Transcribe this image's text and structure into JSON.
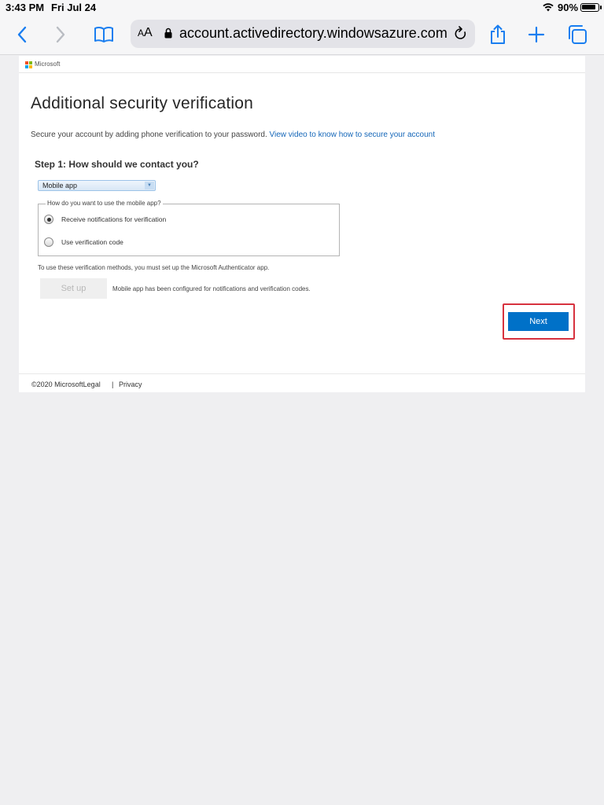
{
  "status_bar": {
    "time": "3:43 PM",
    "date": "Fri Jul 24",
    "battery": "90%"
  },
  "browser": {
    "text_size_label": "AA",
    "url": "account.activedirectory.windowsazure.com",
    "icons": [
      "back-icon",
      "forward-icon",
      "bookmarks-icon",
      "lock-icon",
      "reload-icon",
      "share-icon",
      "new-tab-icon",
      "tabs-icon"
    ],
    "accent_color": "#1a7ef0"
  },
  "header": {
    "brand": "Microsoft"
  },
  "main": {
    "title": "Additional security verification",
    "intro": "Secure your account by adding phone verification to your password.",
    "video_link": "View video to know how to secure your account",
    "step_label": "Step 1: How should we contact you?",
    "method_select": "Mobile app",
    "mobile_app_legend": "How do you want to use the mobile app?",
    "options": [
      {
        "label": "Receive notifications for verification",
        "selected": true
      },
      {
        "label": "Use verification code",
        "selected": false
      }
    ],
    "authenticator_note": "To use these verification methods, you must set up the Microsoft Authenticator app.",
    "setup_button": "Set up",
    "setup_status": "Mobile app has been configured for notifications and verification codes.",
    "next_button": "Next",
    "next_color": "#0071c8",
    "highlight_color": "#d7323e"
  },
  "footer": {
    "copyright": "©2020 Microsoft",
    "legal": "Legal",
    "separator": "|",
    "privacy": "Privacy"
  }
}
